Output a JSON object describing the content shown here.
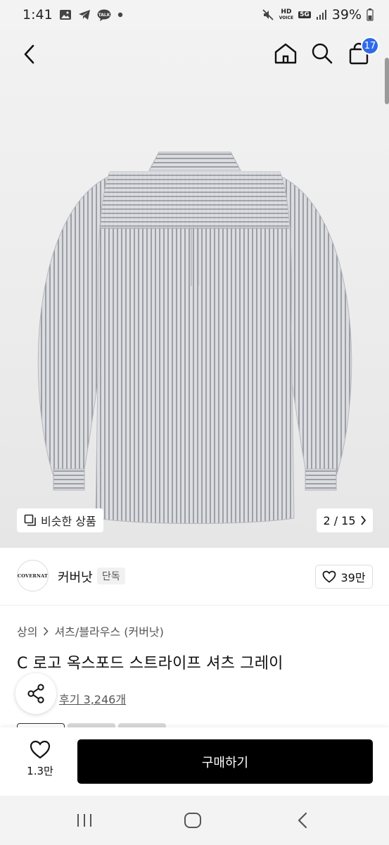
{
  "status_bar": {
    "time": "1:41",
    "battery": "39%",
    "talk_label": "TALK",
    "hd_label": "HD",
    "voice_label": "VOICE",
    "network_label": "5G"
  },
  "header": {
    "cart_count": "17"
  },
  "gallery": {
    "similar_label": "비슷한 상품",
    "page_indicator": "2 / 15"
  },
  "brand": {
    "logo_text": "COVERNAT",
    "name": "커버낫",
    "tag": "단독",
    "like_count": "39만"
  },
  "product": {
    "breadcrumb": [
      "상의",
      "셔츠/블라우스 (커버낫)"
    ],
    "title": "C 로고 옥스포드 스트라이프 셔츠 그레이",
    "review_link": "후기 3,246개"
  },
  "buy_bar": {
    "wish_count": "1.3만",
    "buy_label": "구매하기"
  },
  "colors": {
    "accent": "#2f6ae8",
    "buy_button": "#000000"
  }
}
